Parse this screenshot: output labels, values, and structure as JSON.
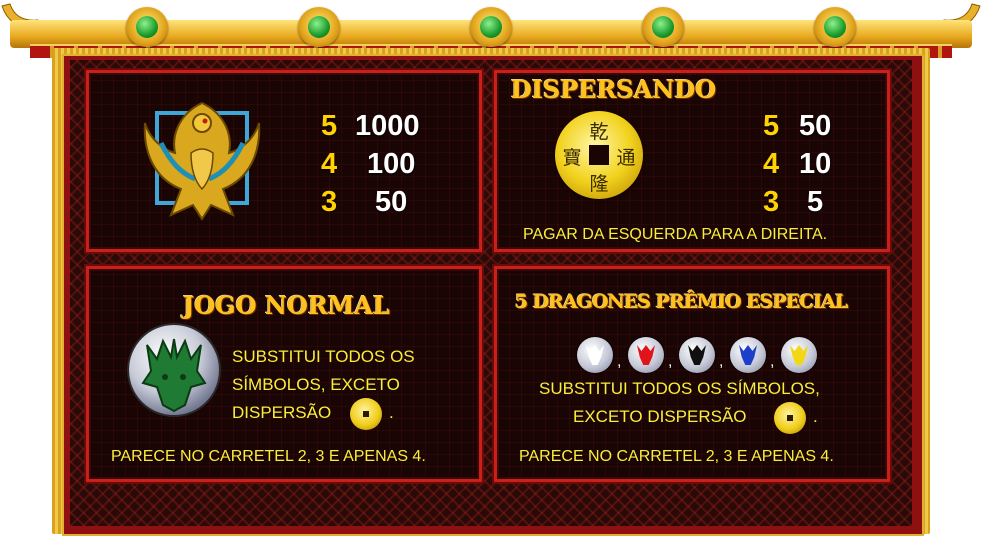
{
  "palette": {
    "gold": "#ffc21c",
    "red": "#c8201a",
    "yellow_text": "#f7ef3a",
    "pay_count": "#ffd200"
  },
  "phoenix_panel": {
    "icon": "phoenix-icon",
    "pays": [
      {
        "count": "5",
        "amount": "1000"
      },
      {
        "count": "4",
        "amount": "100"
      },
      {
        "count": "3",
        "amount": "50"
      }
    ]
  },
  "scatter_panel": {
    "title": "DISPERSANDO",
    "coin_chars": {
      "top": "乾",
      "left": "寶",
      "right": "通",
      "bottom": "隆"
    },
    "pays": [
      {
        "count": "5",
        "amount": "50"
      },
      {
        "count": "4",
        "amount": "10"
      },
      {
        "count": "3",
        "amount": "5"
      }
    ],
    "note": "PAGAR DA ESQUERDA PARA A DIREITA."
  },
  "wild_panel": {
    "title": "JOGO NORMAL",
    "icon": "green-dragon-icon",
    "line1": "SUBSTITUI TODOS OS",
    "line2": "SÍMBOLOS, EXCETO",
    "line3": "DISPERSÃO",
    "period": ".",
    "appears": "PARECE NO CARRETEL 2, 3 E APENAS 4."
  },
  "special_panel": {
    "title": "5 DRAGONES PRÊMIO ESPECIAL",
    "dragons": [
      {
        "icon": "white-dragon-icon",
        "color": "#ffffff"
      },
      {
        "icon": "red-dragon-icon",
        "color": "#e0141a"
      },
      {
        "icon": "black-dragon-icon",
        "color": "#101010"
      },
      {
        "icon": "blue-dragon-icon",
        "color": "#1c3ec8"
      },
      {
        "icon": "yellow-dragon-icon",
        "color": "#f2d814"
      }
    ],
    "separator": ",",
    "line1": "SUBSTITUI TODOS OS SÍMBOLOS,",
    "line2": "EXCETO DISPERSÃO",
    "period": ".",
    "appears": "PARECE NO CARRETEL 2, 3 E APENAS 4."
  }
}
